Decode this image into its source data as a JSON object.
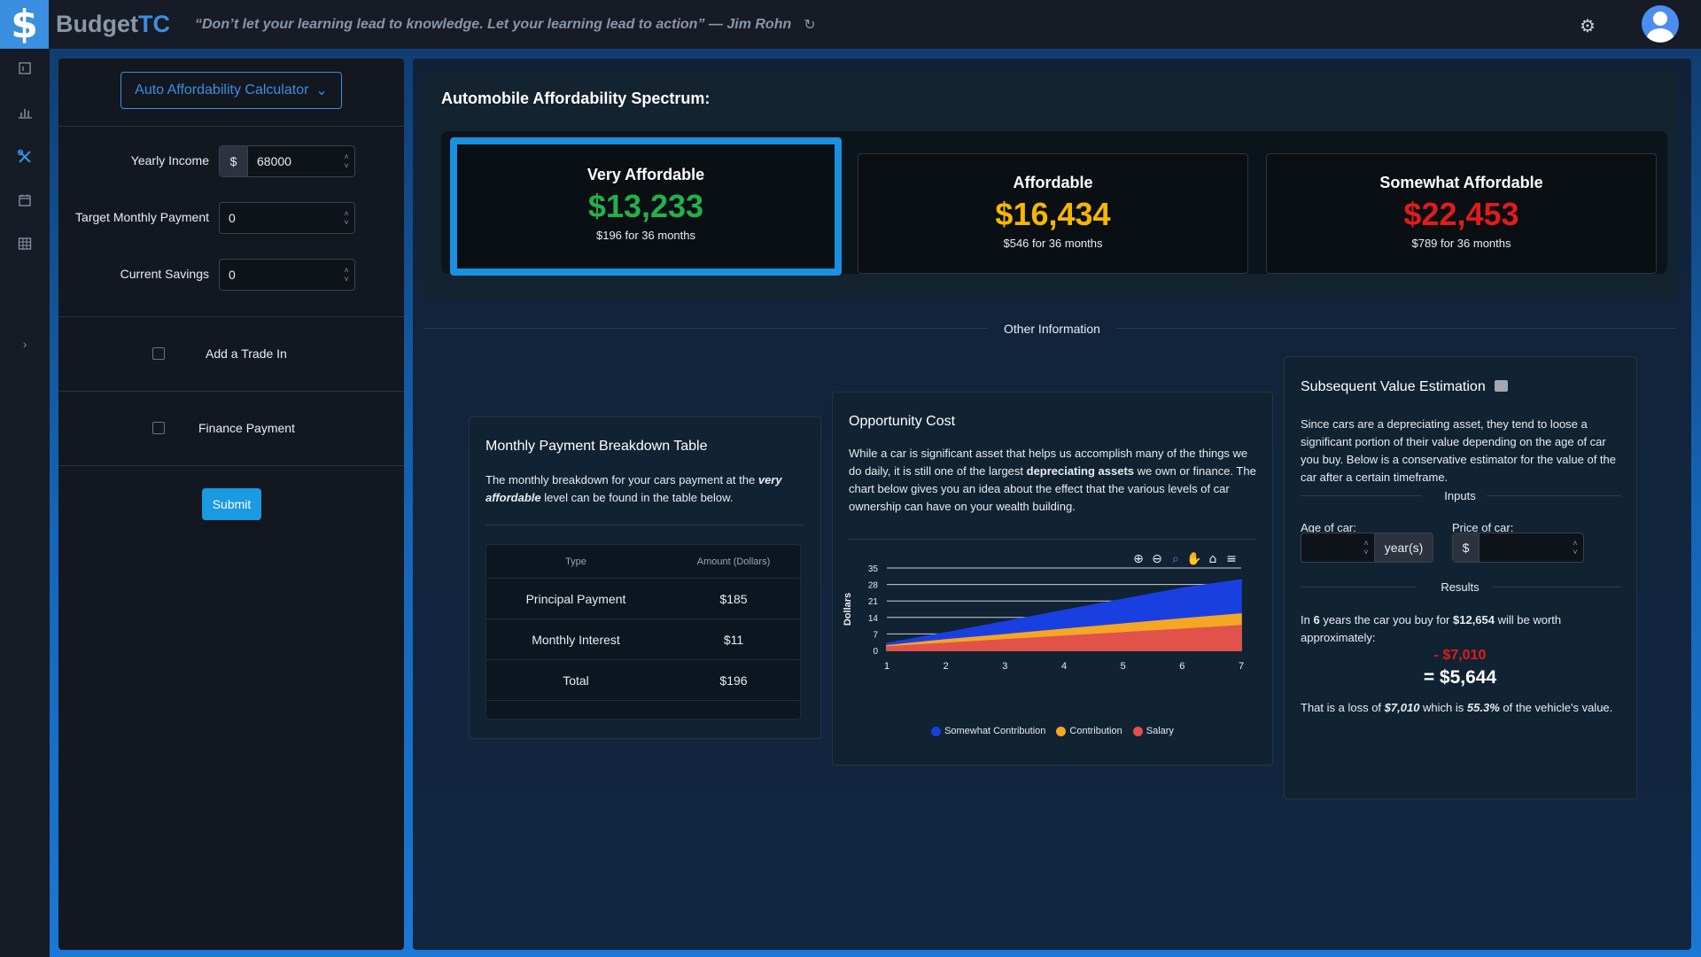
{
  "app": {
    "logo_glyph": "$",
    "brand_main": "Budget",
    "brand_accent": "TC",
    "quote": "“Don’t let your learning lead to knowledge. Let your learning lead to action” — Jim Rohn"
  },
  "rail": {
    "icons": [
      "dashboard-icon",
      "bar-chart-icon",
      "tools-icon",
      "calendar-icon",
      "table-icon",
      "chevron-right-icon"
    ],
    "active": "tools-icon"
  },
  "left": {
    "calculator_select": "Auto Affordability Calculator",
    "fields": [
      {
        "label": "Yearly Income",
        "prefix": "$",
        "value": "68000"
      },
      {
        "label": "Target Monthly Payment",
        "prefix": "",
        "value": "0"
      },
      {
        "label": "Current Savings",
        "prefix": "",
        "value": "0"
      }
    ],
    "trade_in_label": "Add a Trade In",
    "finance_label": "Finance Payment",
    "submit_label": "Submit"
  },
  "spectrum": {
    "title": "Automobile Affordability Spectrum:",
    "tiers": [
      {
        "name": "Very Affordable",
        "price": "$13,233",
        "sub": "$196 for 36 months",
        "color": "#22b14c",
        "selected": true
      },
      {
        "name": "Affordable",
        "price": "$16,434",
        "sub": "$546 for 36 months",
        "color": "#f5b800",
        "selected": false
      },
      {
        "name": "Somewhat Affordable",
        "price": "$22,453",
        "sub": "$789 for 36 months",
        "color": "#e21b1b",
        "selected": false
      }
    ]
  },
  "other_info": "Other Information",
  "breakdown": {
    "title": "Monthly Payment Breakdown Table",
    "desc_1": "The monthly breakdown for your cars payment at the",
    "desc_em": "very affordable",
    "desc_2": " level can be found in the table below.",
    "columns": [
      "Type",
      "Amount (Dollars)"
    ],
    "rows": [
      {
        "type": "Principal Payment",
        "amount": "$185"
      },
      {
        "type": "Monthly Interest",
        "amount": "$11"
      },
      {
        "type": "Total",
        "amount": "$196"
      }
    ]
  },
  "opportunity": {
    "title": "Opportunity Cost",
    "desc_1": "While a car is significant asset that helps us accomplish many of the things we do daily, it is still one of the largest ",
    "desc_bold": "depreciating assets",
    "desc_2": " we own or finance. The chart below gives you an idea about the effect that the various levels of car ownership can have on your wealth building."
  },
  "chart_data": {
    "type": "area",
    "ylabel": "Dollars",
    "x": [
      1,
      2,
      3,
      4,
      5,
      6,
      7
    ],
    "ylim": [
      0,
      35
    ],
    "yticks": [
      0,
      7,
      14,
      21,
      28,
      35
    ],
    "stacked": true,
    "series": [
      {
        "name": "Salary",
        "color": "#e0524a",
        "values": [
          1.5,
          3,
          4.5,
          6,
          7.5,
          9,
          10.5
        ]
      },
      {
        "name": "Contribution",
        "color": "#f5a623",
        "values": [
          0.5,
          1.5,
          2.2,
          3,
          3.7,
          4.4,
          5
        ]
      },
      {
        "name": "Somewhat Contribution",
        "color": "#1a3fe0",
        "values": [
          1,
          3,
          5.5,
          8,
          10.5,
          13,
          14.5
        ]
      }
    ],
    "legend": [
      "Somewhat Contribution",
      "Contribution",
      "Salary"
    ],
    "grid": true,
    "toolbar_icons": [
      "zoom-in-icon",
      "zoom-out-icon",
      "magnify-icon",
      "pan-hand-icon",
      "home-icon",
      "menu-icon"
    ]
  },
  "subsequent": {
    "title": "Subsequent Value Estimation",
    "desc": "Since cars are a depreciating asset, they tend to loose a significant portion of their value depending on the age of car you buy. Below is a conservative estimator for the value of the car after a certain timeframe.",
    "inputs_label": "Inputs",
    "age_label": "Age of car:",
    "age_value": "",
    "age_unit": "year(s)",
    "price_label": "Price of car:",
    "price_prefix": "$",
    "price_value": "",
    "results_label": "Results",
    "res_1": "In ",
    "res_years": "6",
    "res_2": " years the car you buy for ",
    "res_price": "$12,654",
    "res_3": " will be worth approximately:",
    "loss": "- $7,010",
    "worth": "= $5,644",
    "summary_1": "That is a loss of ",
    "summary_loss": "$7,010",
    "summary_2": " which is ",
    "summary_pct": "55.3%",
    "summary_3": " of the vehicle's value."
  }
}
